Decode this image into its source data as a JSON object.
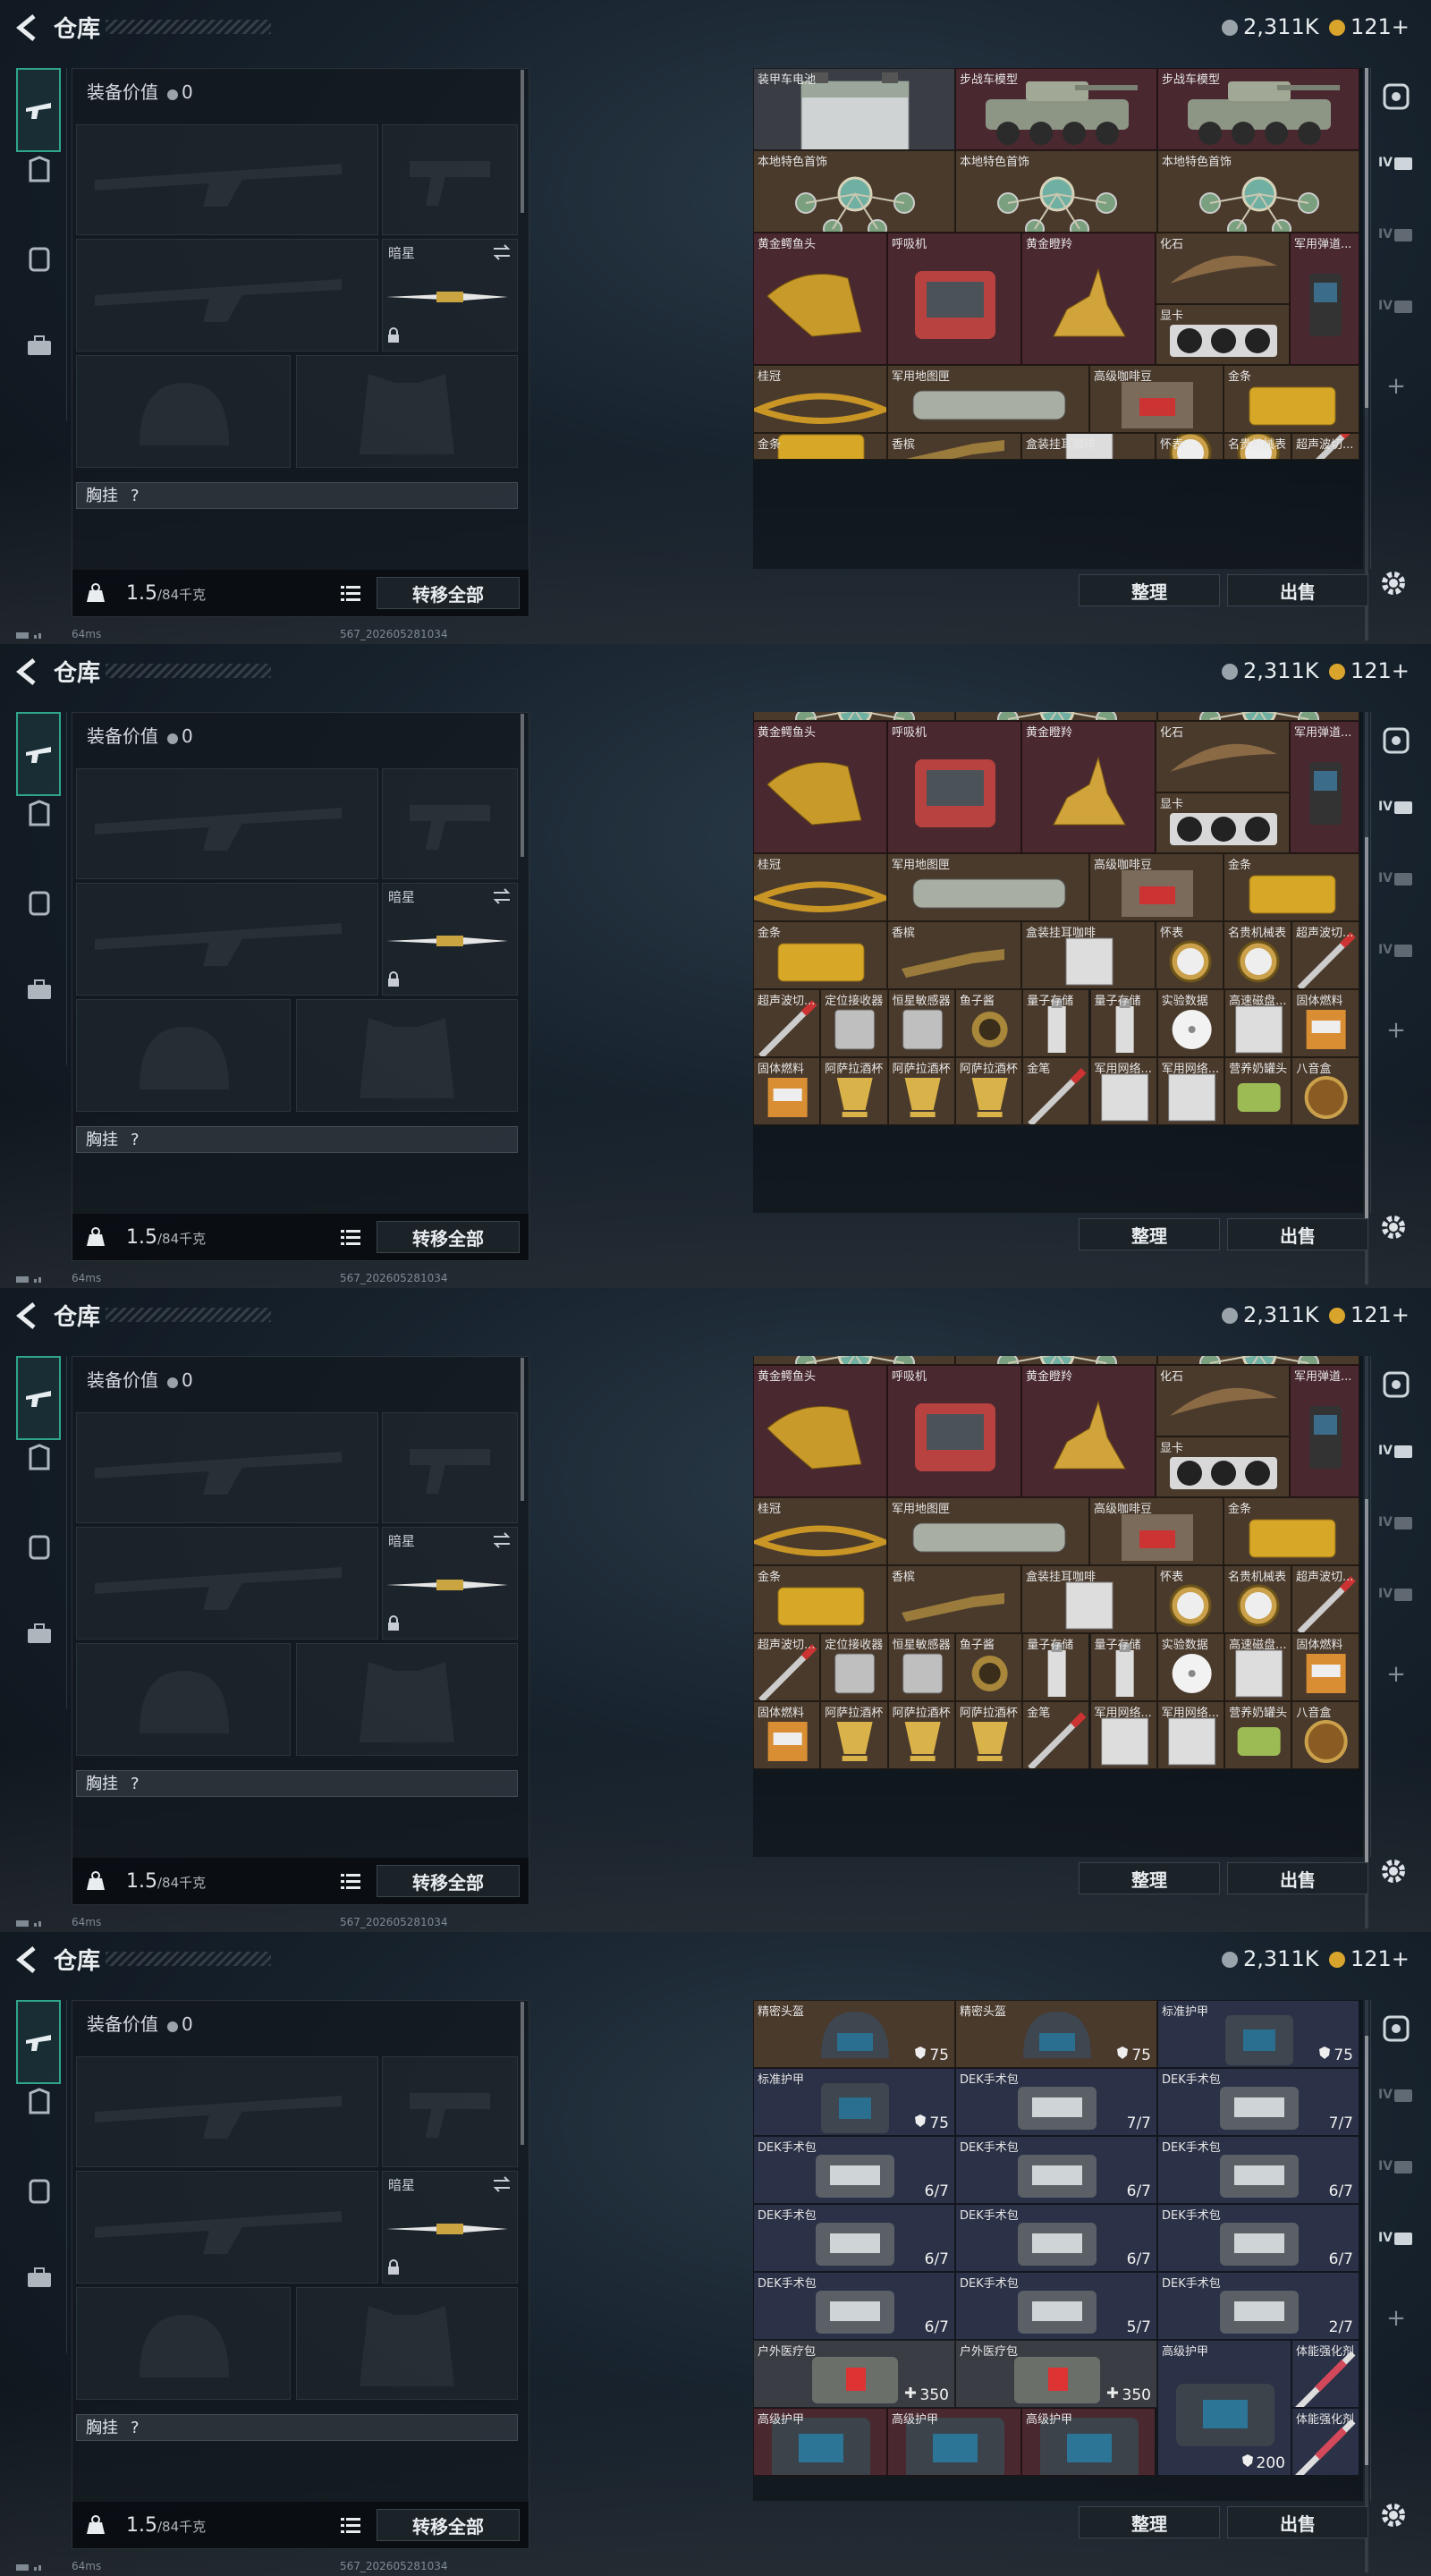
{
  "app": {
    "title": "仓库",
    "currency_silver": "2,311K",
    "currency_gold": "121+",
    "colors": {
      "accent": "#2fa58b",
      "silver": "#9aa3aa",
      "gold": "#d9a42b",
      "cell_red": "#4a2830",
      "cell_brown": "#4a3a2c",
      "cell_blue": "#2b3146",
      "cell_gray": "#3a3e44"
    }
  },
  "left": {
    "equip_value_label": "装备价值",
    "equip_value": "0",
    "melee_name": "暗星",
    "chest_label": "胸挂",
    "chest_help": "?",
    "weight_value": "1.5",
    "weight_max": "/84千克",
    "transfer_all": "转移全部"
  },
  "sidebar_icons": [
    "weapon-icon",
    "armor-icon",
    "backpack-icon",
    "briefcase-icon"
  ],
  "actions": {
    "sort": "整理",
    "sell": "出售"
  },
  "right_nav": {
    "tabs": [
      "safe-box",
      "IV",
      "IV",
      "IV"
    ],
    "plus": "+"
  },
  "status": {
    "ping": "64ms",
    "build": "567_202605281034"
  },
  "frames": [
    {
      "active_tab": 1,
      "cells": [
        {
          "n": "装甲车电池",
          "c": "gray",
          "a": "battery"
        },
        {
          "n": "步战车模型",
          "c": "red",
          "a": "tank"
        },
        {
          "n": "步战车模型",
          "c": "red",
          "a": "tank"
        },
        {
          "n": "本地特色首饰",
          "c": "brown",
          "a": "jewel"
        },
        {
          "n": "本地特色首饰",
          "c": "brown",
          "a": "jewel"
        },
        {
          "n": "本地特色首饰",
          "c": "brown",
          "a": "jewel"
        },
        {
          "n": "黄金鳄鱼头",
          "c": "red",
          "a": "croc"
        },
        {
          "n": "呼吸机",
          "c": "red",
          "a": "vent"
        },
        {
          "n": "黄金瞪羚",
          "c": "red",
          "a": "deer"
        },
        {
          "n": "化石",
          "c": "brown",
          "a": "fossil"
        },
        {
          "n": "军用弹道...",
          "c": "red",
          "a": "pda"
        },
        {
          "n": "显卡",
          "c": "brown",
          "a": "gpu"
        },
        {
          "n": "桂冠",
          "c": "brown",
          "a": "crown"
        },
        {
          "n": "军用地图匣",
          "c": "brown",
          "a": "tube"
        },
        {
          "n": "高级咖啡豆",
          "c": "brown",
          "a": "coffee"
        },
        {
          "n": "金条",
          "c": "brown",
          "a": "gold"
        },
        {
          "n": "金条",
          "c": "brown",
          "a": "gold"
        },
        {
          "n": "香槟",
          "c": "brown",
          "a": "bottle"
        },
        {
          "n": "盒装挂耳咖啡",
          "c": "brown",
          "a": "box"
        },
        {
          "n": "怀表",
          "c": "brown",
          "a": "watch"
        },
        {
          "n": "名贵机械表",
          "c": "brown",
          "a": "watch"
        },
        {
          "n": "超声波切...",
          "c": "brown",
          "a": "pen"
        }
      ]
    },
    {
      "active_tab": 1,
      "cells": [
        {
          "n": "",
          "c": "brown",
          "a": "jewel"
        },
        {
          "n": "",
          "c": "brown",
          "a": "jewel"
        },
        {
          "n": "",
          "c": "brown",
          "a": "jewel"
        },
        {
          "n": "黄金鳄鱼头",
          "c": "red",
          "a": "croc"
        },
        {
          "n": "呼吸机",
          "c": "red",
          "a": "vent"
        },
        {
          "n": "黄金瞪羚",
          "c": "red",
          "a": "deer"
        },
        {
          "n": "化石",
          "c": "brown",
          "a": "fossil"
        },
        {
          "n": "军用弹道...",
          "c": "red",
          "a": "pda"
        },
        {
          "n": "显卡",
          "c": "brown",
          "a": "gpu"
        },
        {
          "n": "桂冠",
          "c": "brown",
          "a": "crown"
        },
        {
          "n": "军用地图匣",
          "c": "brown",
          "a": "tube"
        },
        {
          "n": "高级咖啡豆",
          "c": "brown",
          "a": "coffee"
        },
        {
          "n": "金条",
          "c": "brown",
          "a": "gold"
        },
        {
          "n": "金条",
          "c": "brown",
          "a": "gold"
        },
        {
          "n": "香槟",
          "c": "brown",
          "a": "bottle"
        },
        {
          "n": "盒装挂耳咖啡",
          "c": "brown",
          "a": "box"
        },
        {
          "n": "怀表",
          "c": "brown",
          "a": "watch"
        },
        {
          "n": "名贵机械表",
          "c": "brown",
          "a": "watch"
        },
        {
          "n": "超声波切...",
          "c": "brown",
          "a": "pen"
        },
        {
          "n": "超声波切...",
          "c": "brown",
          "a": "pen"
        },
        {
          "n": "定位接收器",
          "c": "brown",
          "a": "device"
        },
        {
          "n": "恒星敏感器",
          "c": "brown",
          "a": "device"
        },
        {
          "n": "鱼子酱",
          "c": "brown",
          "a": "jar"
        },
        {
          "n": "量子存储",
          "c": "brown",
          "a": "usb"
        },
        {
          "n": "量子存储",
          "c": "brown",
          "a": "usb"
        },
        {
          "n": "实验数据",
          "c": "brown",
          "a": "disc"
        },
        {
          "n": "高速磁盘...",
          "c": "brown",
          "a": "box"
        },
        {
          "n": "固体燃料",
          "c": "brown",
          "a": "fuel"
        },
        {
          "n": "固体燃料",
          "c": "brown",
          "a": "fuel"
        },
        {
          "n": "阿萨拉酒杯",
          "c": "brown",
          "a": "cup"
        },
        {
          "n": "阿萨拉酒杯",
          "c": "brown",
          "a": "cup"
        },
        {
          "n": "阿萨拉酒杯",
          "c": "brown",
          "a": "cup"
        },
        {
          "n": "金笔",
          "c": "brown",
          "a": "pen"
        },
        {
          "n": "军用网络...",
          "c": "brown",
          "a": "box"
        },
        {
          "n": "军用网络...",
          "c": "brown",
          "a": "box"
        },
        {
          "n": "营养奶罐头",
          "c": "brown",
          "a": "can"
        },
        {
          "n": "八音盒",
          "c": "brown",
          "a": "music"
        }
      ]
    },
    {
      "active_tab": 1,
      "cells": [
        {
          "n": "",
          "c": "brown",
          "a": "jewel"
        },
        {
          "n": "",
          "c": "brown",
          "a": "jewel"
        },
        {
          "n": "",
          "c": "brown",
          "a": "jewel"
        },
        {
          "n": "黄金鳄鱼头",
          "c": "red",
          "a": "croc"
        },
        {
          "n": "呼吸机",
          "c": "red",
          "a": "vent"
        },
        {
          "n": "黄金瞪羚",
          "c": "red",
          "a": "deer"
        },
        {
          "n": "化石",
          "c": "brown",
          "a": "fossil"
        },
        {
          "n": "军用弹道...",
          "c": "red",
          "a": "pda"
        },
        {
          "n": "显卡",
          "c": "brown",
          "a": "gpu"
        },
        {
          "n": "桂冠",
          "c": "brown",
          "a": "crown"
        },
        {
          "n": "军用地图匣",
          "c": "brown",
          "a": "tube"
        },
        {
          "n": "高级咖啡豆",
          "c": "brown",
          "a": "coffee"
        },
        {
          "n": "金条",
          "c": "brown",
          "a": "gold"
        },
        {
          "n": "金条",
          "c": "brown",
          "a": "gold"
        },
        {
          "n": "香槟",
          "c": "brown",
          "a": "bottle"
        },
        {
          "n": "盒装挂耳咖啡",
          "c": "brown",
          "a": "box"
        },
        {
          "n": "怀表",
          "c": "brown",
          "a": "watch"
        },
        {
          "n": "名贵机械表",
          "c": "brown",
          "a": "watch"
        },
        {
          "n": "超声波切...",
          "c": "brown",
          "a": "pen"
        },
        {
          "n": "超声波切...",
          "c": "brown",
          "a": "pen"
        },
        {
          "n": "定位接收器",
          "c": "brown",
          "a": "device"
        },
        {
          "n": "恒星敏感器",
          "c": "brown",
          "a": "device"
        },
        {
          "n": "鱼子酱",
          "c": "brown",
          "a": "jar"
        },
        {
          "n": "量子存储",
          "c": "brown",
          "a": "usb"
        },
        {
          "n": "量子存储",
          "c": "brown",
          "a": "usb"
        },
        {
          "n": "实验数据",
          "c": "brown",
          "a": "disc"
        },
        {
          "n": "高速磁盘...",
          "c": "brown",
          "a": "box"
        },
        {
          "n": "固体燃料",
          "c": "brown",
          "a": "fuel"
        },
        {
          "n": "固体燃料",
          "c": "brown",
          "a": "fuel"
        },
        {
          "n": "阿萨拉酒杯",
          "c": "brown",
          "a": "cup"
        },
        {
          "n": "阿萨拉酒杯",
          "c": "brown",
          "a": "cup"
        },
        {
          "n": "阿萨拉酒杯",
          "c": "brown",
          "a": "cup"
        },
        {
          "n": "金笔",
          "c": "brown",
          "a": "pen"
        },
        {
          "n": "军用网络...",
          "c": "brown",
          "a": "box"
        },
        {
          "n": "军用网络...",
          "c": "brown",
          "a": "box"
        },
        {
          "n": "营养奶罐头",
          "c": "brown",
          "a": "can"
        },
        {
          "n": "八音盒",
          "c": "brown",
          "a": "music"
        }
      ]
    },
    {
      "active_tab": 3,
      "cells": [
        {
          "n": "精密头盔",
          "c": "brown",
          "a": "helmet",
          "b": "75",
          "bi": "shield"
        },
        {
          "n": "精密头盔",
          "c": "brown",
          "a": "helmet",
          "b": "75",
          "bi": "shield"
        },
        {
          "n": "标准护甲",
          "c": "blue",
          "a": "vest",
          "b": "75",
          "bi": "shield"
        },
        {
          "n": "标准护甲",
          "c": "blue",
          "a": "vest",
          "b": "75",
          "bi": "shield"
        },
        {
          "n": "DEK手术包",
          "c": "blue",
          "a": "kit",
          "b": "7/7"
        },
        {
          "n": "DEK手术包",
          "c": "blue",
          "a": "kit",
          "b": "7/7"
        },
        {
          "n": "DEK手术包",
          "c": "blue",
          "a": "kit",
          "b": "6/7"
        },
        {
          "n": "DEK手术包",
          "c": "blue",
          "a": "kit",
          "b": "6/7"
        },
        {
          "n": "DEK手术包",
          "c": "blue",
          "a": "kit",
          "b": "6/7"
        },
        {
          "n": "DEK手术包",
          "c": "blue",
          "a": "kit",
          "b": "6/7"
        },
        {
          "n": "DEK手术包",
          "c": "blue",
          "a": "kit",
          "b": "6/7"
        },
        {
          "n": "DEK手术包",
          "c": "blue",
          "a": "kit",
          "b": "6/7"
        },
        {
          "n": "DEK手术包",
          "c": "blue",
          "a": "kit",
          "b": "6/7"
        },
        {
          "n": "DEK手术包",
          "c": "blue",
          "a": "kit",
          "b": "5/7"
        },
        {
          "n": "DEK手术包",
          "c": "blue",
          "a": "kit",
          "b": "2/7"
        },
        {
          "n": "户外医疗包",
          "c": "gray",
          "a": "medbag",
          "b": "350",
          "bi": "plus"
        },
        {
          "n": "户外医疗包",
          "c": "gray",
          "a": "medbag",
          "b": "350",
          "bi": "plus"
        },
        {
          "n": "高级护甲",
          "c": "blue",
          "a": "bigvest",
          "b": "200",
          "bi": "shield"
        },
        {
          "n": "体能强化剂",
          "c": "blue",
          "a": "syringe"
        },
        {
          "n": "高级护甲",
          "c": "red",
          "a": "bigvest"
        },
        {
          "n": "高级护甲",
          "c": "red",
          "a": "bigvest"
        },
        {
          "n": "高级护甲",
          "c": "red",
          "a": "bigvest"
        },
        {
          "n": "体能强化剂",
          "c": "blue",
          "a": "syringe"
        }
      ]
    }
  ]
}
